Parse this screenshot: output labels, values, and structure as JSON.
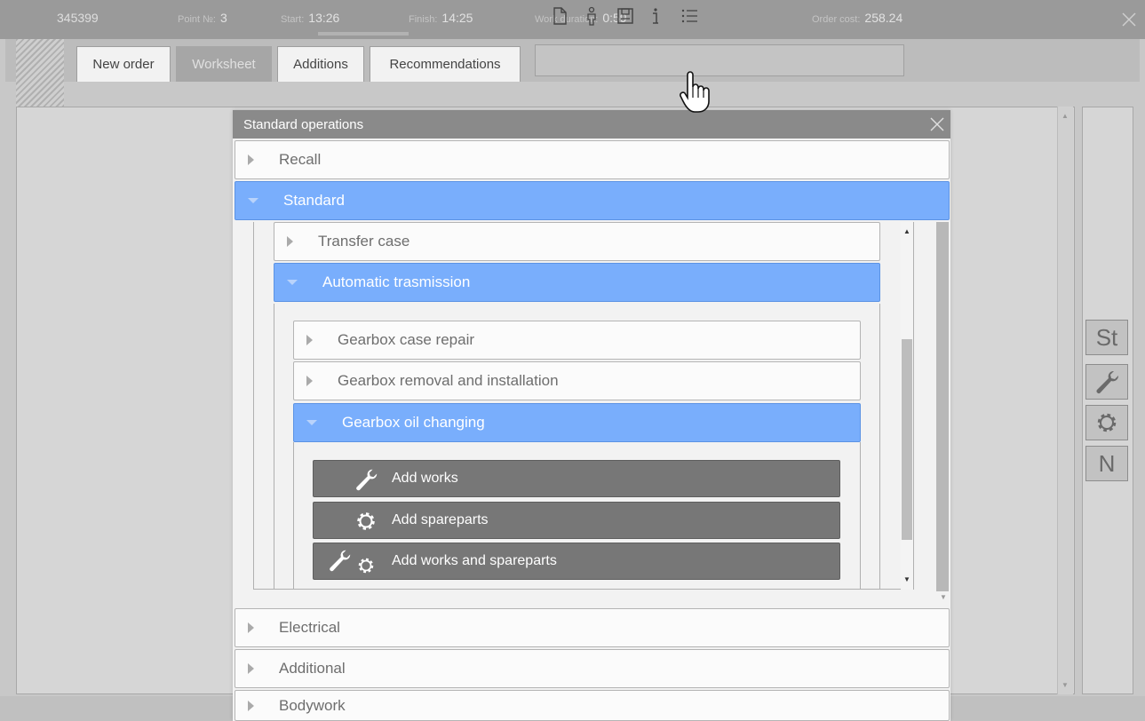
{
  "topbar": {
    "order_no": "345399",
    "point_label": "Point №:",
    "point_value": "3",
    "start_label": "Start:",
    "start_value": "13:26",
    "finish_label": "Finish:",
    "finish_value": "14:25",
    "duration_label": "Work duration:",
    "duration_value": "0:59",
    "cost_label": "Order cost:",
    "cost_value": "258.24"
  },
  "tabs": [
    {
      "label": "New order",
      "active": false
    },
    {
      "label": "Worksheet",
      "active": true
    },
    {
      "label": "Additions",
      "active": false
    },
    {
      "label": "Recommendations",
      "active": false
    }
  ],
  "toolbar_icons": [
    "new-document-icon",
    "person-icon",
    "save-icon",
    "info-icon",
    "list-icon"
  ],
  "side_buttons": [
    {
      "label": "St",
      "icon": null
    },
    {
      "label": "",
      "icon": "wrench-icon"
    },
    {
      "label": "",
      "icon": "gear-icon"
    },
    {
      "label": "N",
      "icon": null
    }
  ],
  "dialog": {
    "title": "Standard operations",
    "groups": {
      "recall": "Recall",
      "standard": "Standard",
      "electrical": "Electrical",
      "additional": "Additional",
      "bodywork": "Bodywork"
    },
    "subgroups": {
      "transfer_case": "Transfer case",
      "automatic_transmission": "Automatic trasmission"
    },
    "operations": {
      "case_repair": "Gearbox case repair",
      "removal_installation": "Gearbox removal and installation",
      "oil_changing": "Gearbox oil changing"
    },
    "actions": {
      "add_works": "Add works",
      "add_spareparts": "Add spareparts",
      "add_both": "Add works and spareparts"
    }
  },
  "colors": {
    "accent_open": "#79aefc",
    "action_button": "#777777",
    "title_bar": "#8a8a8a"
  }
}
